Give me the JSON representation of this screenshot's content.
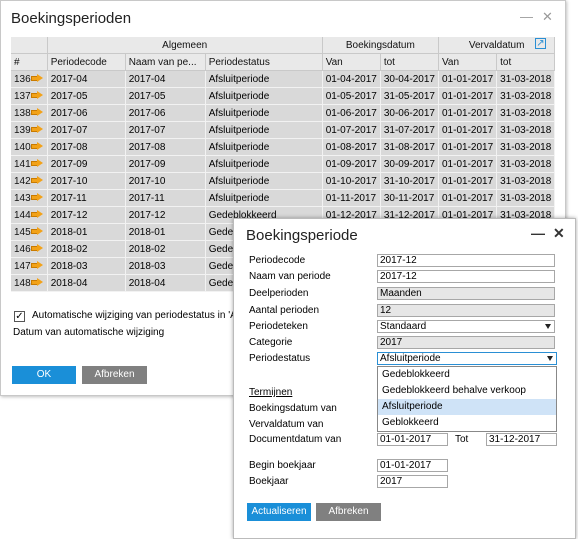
{
  "main": {
    "title": "Boekingsperioden",
    "controls": {
      "minimize": "—",
      "close": "✕"
    },
    "groups": {
      "general": "Algemeen",
      "booking": "Boekingsdatum",
      "due": "Vervaldatum"
    },
    "columns": [
      "#",
      "Periodecode",
      "Naam van pe...",
      "Periodestatus",
      "Van",
      "tot",
      "Van",
      "tot"
    ],
    "rows": [
      [
        "136",
        "2017-04",
        "2017-04",
        "Afsluitperiode",
        "01-04-2017",
        "30-04-2017",
        "01-01-2017",
        "31-03-2018"
      ],
      [
        "137",
        "2017-05",
        "2017-05",
        "Afsluitperiode",
        "01-05-2017",
        "31-05-2017",
        "01-01-2017",
        "31-03-2018"
      ],
      [
        "138",
        "2017-06",
        "2017-06",
        "Afsluitperiode",
        "01-06-2017",
        "30-06-2017",
        "01-01-2017",
        "31-03-2018"
      ],
      [
        "139",
        "2017-07",
        "2017-07",
        "Afsluitperiode",
        "01-07-2017",
        "31-07-2017",
        "01-01-2017",
        "31-03-2018"
      ],
      [
        "140",
        "2017-08",
        "2017-08",
        "Afsluitperiode",
        "01-08-2017",
        "31-08-2017",
        "01-01-2017",
        "31-03-2018"
      ],
      [
        "141",
        "2017-09",
        "2017-09",
        "Afsluitperiode",
        "01-09-2017",
        "30-09-2017",
        "01-01-2017",
        "31-03-2018"
      ],
      [
        "142",
        "2017-10",
        "2017-10",
        "Afsluitperiode",
        "01-10-2017",
        "31-10-2017",
        "01-01-2017",
        "31-03-2018"
      ],
      [
        "143",
        "2017-11",
        "2017-11",
        "Afsluitperiode",
        "01-11-2017",
        "30-11-2017",
        "01-01-2017",
        "31-03-2018"
      ],
      [
        "144",
        "2017-12",
        "2017-12",
        "Gedeblokkeerd",
        "01-12-2017",
        "31-12-2017",
        "01-01-2017",
        "31-03-2018"
      ],
      [
        "145",
        "2018-01",
        "2018-01",
        "Gedeblok",
        "",
        "",
        "",
        ""
      ],
      [
        "146",
        "2018-02",
        "2018-02",
        "Gedeblok",
        "",
        "",
        "",
        ""
      ],
      [
        "147",
        "2018-03",
        "2018-03",
        "Gedeblok",
        "",
        "",
        "",
        ""
      ],
      [
        "148",
        "2018-04",
        "2018-04",
        "Gedeblok",
        "",
        "",
        "",
        ""
      ]
    ],
    "auto_change_label": "Automatische wijziging van periodestatus in 'A",
    "auto_change_date_label": "Datum van automatische wijziging",
    "ok_label": "OK",
    "cancel_label": "Afbreken"
  },
  "dialog": {
    "title": "Boekingsperiode",
    "controls": {
      "minimize": "—",
      "close": "✕"
    },
    "labels": {
      "code": "Periodecode",
      "name": "Naam van periode",
      "subperiods": "Deelperioden",
      "count": "Aantal perioden",
      "indicator": "Periodeteken",
      "category": "Categorie",
      "status": "Periodestatus",
      "terms": "Termijnen",
      "booking_date": "Boekingsdatum van",
      "due_date": "Vervaldatum van",
      "doc_date": "Documentdatum van",
      "to": "Tot",
      "fy_start": "Begin boekjaar",
      "fy": "Boekjaar"
    },
    "values": {
      "code": "2017-12",
      "name": "2017-12",
      "subperiods": "Maanden",
      "count": "12",
      "indicator": "Standaard",
      "category": "2017",
      "status": "Afsluitperiode",
      "doc_from": "01-01-2017",
      "doc_to": "31-12-2017",
      "fy_start": "01-01-2017",
      "fy": "2017"
    },
    "status_options": [
      "Gedeblokkeerd",
      "Gedeblokkeerd behalve verkoop",
      "Afsluitperiode",
      "Geblokkeerd"
    ],
    "selected_option": "Afsluitperiode",
    "update_label": "Actualiseren",
    "cancel_label": "Afbreken"
  },
  "colors": {
    "accent": "#1a8fd8",
    "arrow": "#f2a218",
    "row_bg": "#d9d9d9",
    "selected_option": "#cfe3f7"
  }
}
